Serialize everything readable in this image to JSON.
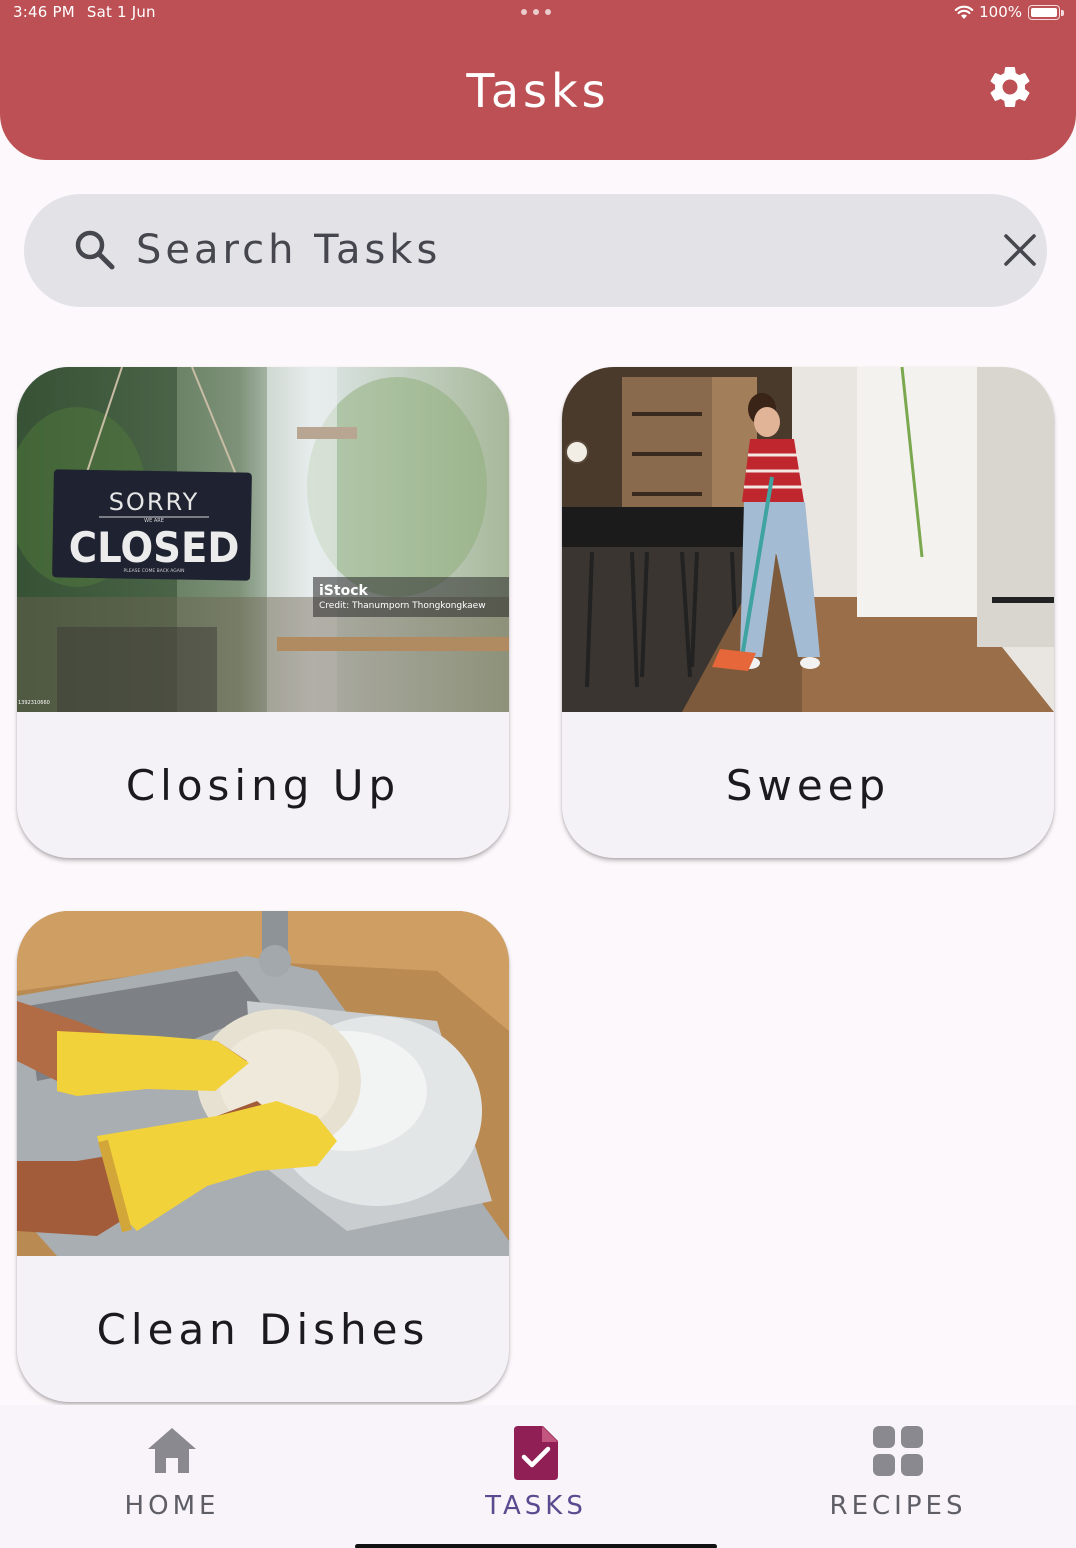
{
  "status_bar": {
    "time": "3:46 PM",
    "date": "Sat 1 Jun",
    "battery": "100%"
  },
  "app_bar": {
    "title": "Tasks",
    "settings_icon": "gear-icon"
  },
  "search": {
    "placeholder": "Search Tasks",
    "value": "",
    "search_icon": "search-icon",
    "clear_icon": "close-icon"
  },
  "tasks": [
    {
      "label": "Closing Up",
      "image_sign_line1": "SORRY",
      "image_sign_line2": "WE ARE",
      "image_sign_line3": "CLOSED",
      "image_sign_line4": "PLEASE COME BACK AGAIN",
      "image_watermark_brand": "iStock",
      "image_watermark_credit": "Credit: Thanumporn Thongkongkaew",
      "image_watermark_id": "1392310660"
    },
    {
      "label": "Sweep"
    },
    {
      "label": "Clean Dishes"
    }
  ],
  "bottom_nav": {
    "items": [
      {
        "label": "HOME",
        "icon": "home-icon",
        "active": false
      },
      {
        "label": "TASKS",
        "icon": "task-document-icon",
        "active": true
      },
      {
        "label": "RECIPES",
        "icon": "grid-icon",
        "active": false
      }
    ]
  },
  "colors": {
    "app_bar": "#bd5054",
    "background": "#fdf8fb",
    "search_bar": "#e3e2e6",
    "card": "#f4f2f7",
    "active_nav_icon": "#8f1f54",
    "active_nav_label": "#5b4a8f",
    "inactive_nav": "#5f5e66"
  }
}
